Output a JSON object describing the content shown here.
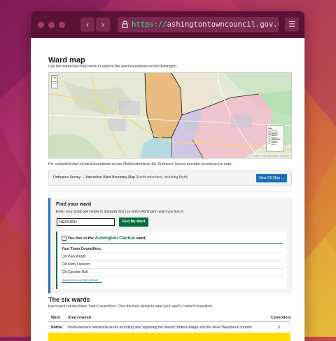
{
  "browser": {
    "url_scheme": "https://",
    "url_host": "ashingtontowncouncil.gov.uk",
    "back_glyph": "‹",
    "forward_glyph": "›",
    "menu_glyph": "☰"
  },
  "ward_map": {
    "title": "Ward map",
    "intro": "Use the interactive map below to explore the ward boundaries across Ashington.",
    "zoom_in": "+",
    "zoom_out": "−",
    "legend_title": "Key",
    "legend_items": [
      {
        "label": "Bothal Ward",
        "color": "#f2a7b8"
      },
      {
        "label": "Central Ward",
        "color": "#e2a25a"
      },
      {
        "label": "Haydon Ward",
        "color": "#b9a7e6"
      },
      {
        "label": "Hirst Ward",
        "color": "#9cd3e6"
      },
      {
        "label": "Seaton Ward",
        "color": "#f4b6d0"
      },
      {
        "label": "College Ward",
        "color": "#a6dfa6"
      }
    ],
    "attribution": "© Leaflet | © OpenStreetMap contributors",
    "os_note": "For a detailed view of ward boundaries across Northumberland, the Ordnance Survey provides an interactive map:",
    "os_panel_title": "Ordnance Survey — Interactive Ward Boundary Map",
    "os_panel_note": "(Northumberland, including Blyth)",
    "os_button": "View OS Map →"
  },
  "find_ward": {
    "title": "Find your ward",
    "instruction": "Enter your postcode below to instantly find out which Ashington ward you live in.",
    "postcode_value": "NE63 8RU",
    "button": "Find My Ward",
    "result_prefix": "You live in the",
    "result_ward": "Ashington Central",
    "result_suffix": "ward.",
    "councillors_heading": "Your Town Councillors:",
    "councillors": [
      "Cllr Paul Wright",
      "Cllr Kerry Davison",
      "Cllr Caroline Ball"
    ],
    "details_link": "View full councillor details →"
  },
  "six_wards": {
    "title": "The six wards",
    "intro": "Each ward returns three Town Councillors. Click the links below to view your ward's current councillors.",
    "columns": [
      "Ward",
      "Area covered",
      "Councillors"
    ],
    "rows": [
      {
        "ward": "Bothal",
        "area": "North-western residential areas including land adjoining the historic Bothal village and the River Wansbeck corridor",
        "councillors": "3"
      }
    ]
  },
  "colors": {
    "gov_blue": "#1d70b8",
    "gov_green": "#00703c",
    "highlight_yellow": "#ffdd00",
    "chrome": "#5a1236"
  }
}
